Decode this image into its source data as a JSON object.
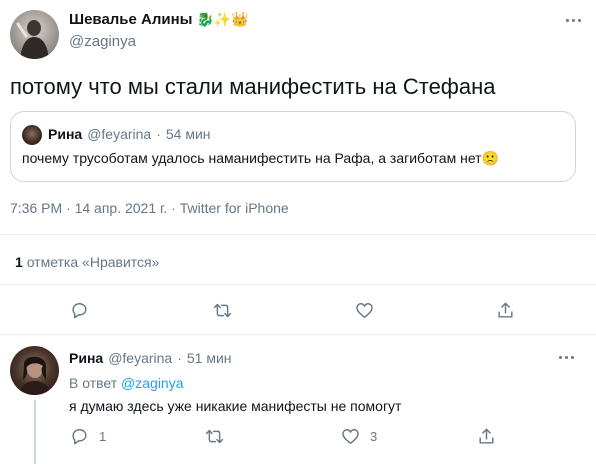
{
  "tweet": {
    "author_name": "Шевалье Алины",
    "author_emojis": "🐉✨👑",
    "author_handle": "@zaginya",
    "text": "потому что мы стали манифестить на Стефана",
    "quote": {
      "author_name": "Рина",
      "author_handle": "@feyarina",
      "separator": "·",
      "time": "54 мин",
      "text": "почему трусоботам удалось наманифестить на Рафа, а загиботам нет",
      "emoji": "🙁"
    },
    "meta": "7:36 PM · 14 апр. 2021 г. · Twitter for iPhone",
    "likes_count": "1",
    "likes_label": "отметка «Нравится»"
  },
  "reply": {
    "author_name": "Рина",
    "author_handle": "@feyarina",
    "separator": "·",
    "time": "51 мин",
    "reply_to_prefix": "В ответ",
    "reply_to_handle": "@zaginya",
    "text": "я думаю здесь уже никакие манифесты не помогут",
    "reply_count": "1",
    "retweet_count": "",
    "like_count": "3"
  },
  "icons": {
    "reply": "reply-icon",
    "retweet": "retweet-icon",
    "like": "heart-icon",
    "share": "share-icon",
    "more": "more-icon"
  },
  "colors": {
    "accent": "#1da1f2",
    "muted": "#657786",
    "divider": "#e6ecf0",
    "text": "#0f1419"
  }
}
